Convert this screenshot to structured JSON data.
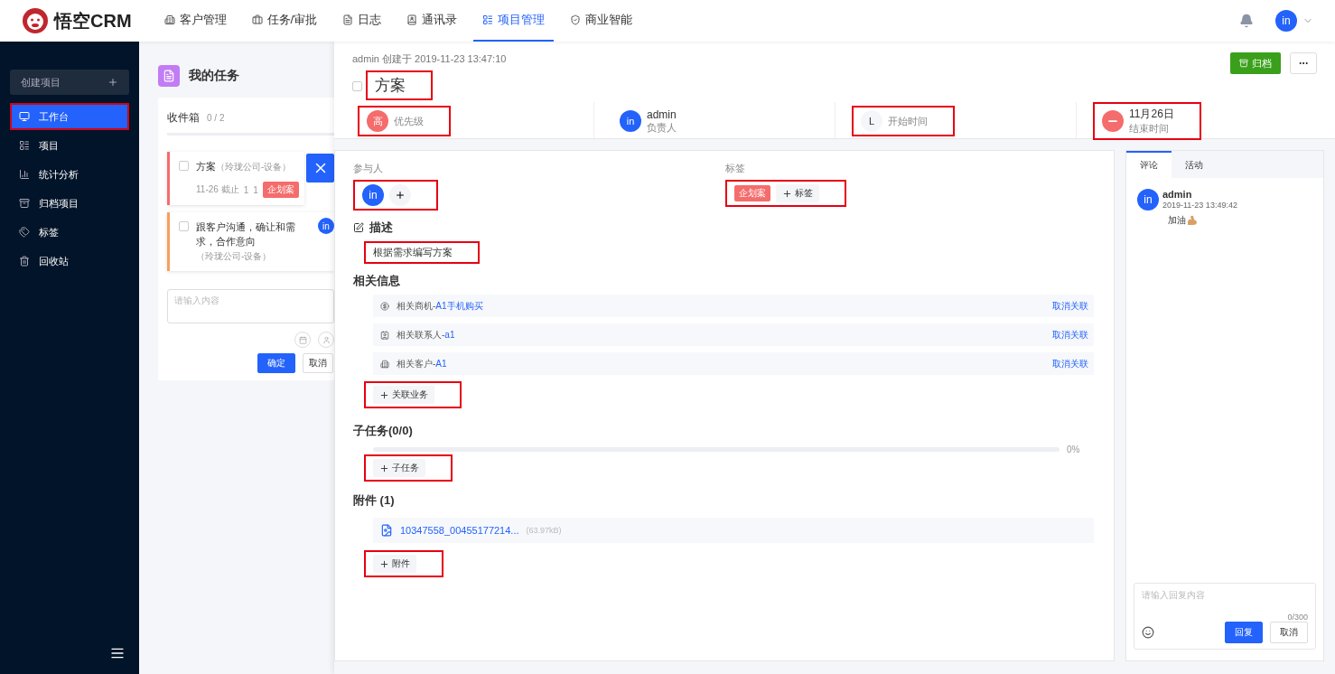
{
  "logo": {
    "text": "悟空CRM"
  },
  "nav": [
    {
      "label": "客户管理",
      "selected": false
    },
    {
      "label": "任务/审批",
      "selected": false
    },
    {
      "label": "日志",
      "selected": false
    },
    {
      "label": "通讯录",
      "selected": false
    },
    {
      "label": "项目管理",
      "selected": true
    },
    {
      "label": "商业智能",
      "selected": false
    }
  ],
  "user": {
    "avatar": "in"
  },
  "sidebar": {
    "create": "创建项目",
    "items": [
      {
        "label": "工作台",
        "selected": true,
        "highlighted": true
      },
      {
        "label": "项目",
        "selected": false,
        "highlighted": false
      },
      {
        "label": "统计分析",
        "selected": false,
        "highlighted": false
      },
      {
        "label": "归档项目",
        "selected": false,
        "highlighted": false
      },
      {
        "label": "标签",
        "selected": false,
        "highlighted": false
      },
      {
        "label": "回收站",
        "selected": false,
        "highlighted": false
      }
    ]
  },
  "my_tasks": {
    "title": "我的任务",
    "inbox": "收件箱",
    "count": "0 / 2",
    "tasks": [
      {
        "title": "方案",
        "company": "（玲珑公司-设备）",
        "due": "11-26 截止",
        "count_1": "1",
        "count_2": "1",
        "tag": "企划案",
        "color": "#f56c6c",
        "checked": false
      },
      {
        "title": "跟客户沟通，确让和需求，合作意向",
        "company": "（玲珑公司-设备）",
        "avatar": "in",
        "color": "#f89f5b",
        "checked": false
      }
    ],
    "input": {
      "placeholder": "请输入内容"
    },
    "confirm": "确定",
    "cancel": "取消"
  },
  "detail": {
    "meta": "admin 创建于 2019-11-23 13:47:10",
    "archive": "归档",
    "title": {
      "text": "方案",
      "checked": false,
      "highlighted": true
    },
    "stats": [
      {
        "kind": "priority",
        "badge": "高",
        "label": "优先级",
        "highlighted": true
      },
      {
        "kind": "owner",
        "badge": "in",
        "value": "admin",
        "label": "负责人",
        "highlighted": false
      },
      {
        "kind": "start",
        "badge": "L",
        "label": "开始时间",
        "highlighted": true
      },
      {
        "kind": "end",
        "value": "11月26日",
        "label": "结束时间",
        "highlighted": true
      }
    ],
    "participants": {
      "label": "参与人",
      "avatars": [
        "in"
      ],
      "highlighted": true
    },
    "tags": {
      "label": "标签",
      "items": [
        {
          "text": "企划案",
          "color": "#f56c6c"
        }
      ],
      "add": "标签",
      "highlighted": true
    },
    "description": {
      "heading": "描述",
      "text": "根据需求编写方案",
      "highlighted": true
    },
    "related": {
      "heading": "相关信息",
      "rows": [
        {
          "prefix": "相关商机-",
          "link": "A1手机购买",
          "action": "取消关联"
        },
        {
          "prefix": "相关联系人-",
          "link": "a1",
          "action": "取消关联"
        },
        {
          "prefix": "相关客户-",
          "link": "A1",
          "action": "取消关联"
        }
      ],
      "add": "关联业务",
      "highlighted": true
    },
    "subtasks": {
      "heading": "子任务(0/0)",
      "level": 0,
      "percent": "0%",
      "add": "子任务",
      "highlighted": true
    },
    "attachments": {
      "heading": "附件 (1)",
      "files": [
        {
          "name": "10347558_00455177214...",
          "size": "(63.97kB)"
        }
      ],
      "add": "附件",
      "highlighted": true
    },
    "comments": {
      "tabs": [
        {
          "label": "评论",
          "selected": true
        },
        {
          "label": "活动",
          "selected": false
        }
      ],
      "items": [
        {
          "avatar": "in",
          "author": "admin",
          "time": "2019-11-23 13:49:42",
          "text": "加油"
        }
      ],
      "reply": {
        "placeholder": "请输入回复内容",
        "counter": "0/300",
        "submit": "回复",
        "cancel": "取消"
      }
    }
  }
}
